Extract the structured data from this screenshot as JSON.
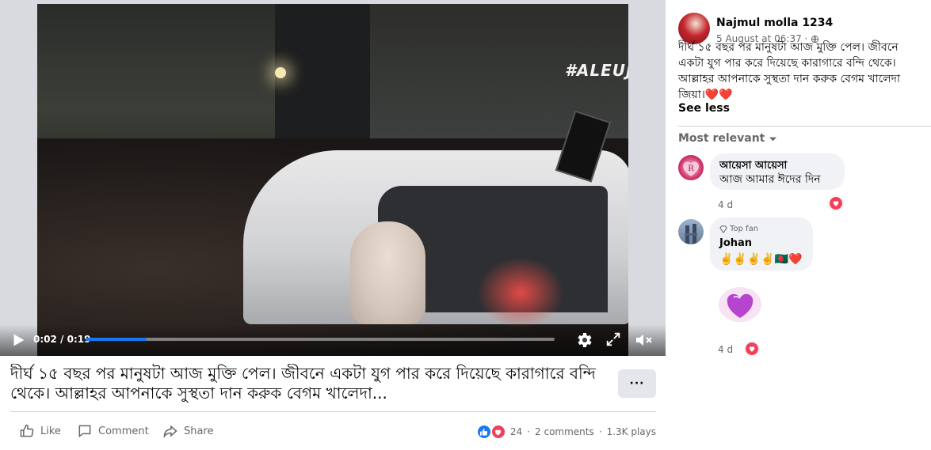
{
  "video": {
    "watermark": "#ALEUJAR",
    "time_current": "0:02",
    "time_separator": " / ",
    "time_total": "0:19",
    "progress": 0.13
  },
  "post": {
    "caption": "দীর্ঘ ১৫ বছর পর মানুষটা আজ মুক্তি পেল। জীবনে একটা যুগ পার করে দিয়েছে কারাগারে বন্দি থেকে। আল্লাহর আপনাকে সুস্থতা দান করুক বেগম খালেদা...",
    "more_label": "···",
    "actions": {
      "like": "Like",
      "comment": "Comment",
      "share": "Share"
    },
    "stats": {
      "reactions": "24",
      "comments": "2 comments",
      "separator": "·",
      "plays": "1.3K plays"
    }
  },
  "panel": {
    "author": "Najmul molla 1234",
    "timestamp": "5 August at 06:37 ·",
    "text": "দীর্ঘ ১৫ বছর পর মানুষটা আজ মুক্তি পেল। জীবনে একটা যুগ পার করে দিয়েছে কারাগারে বন্দি থেকে। আল্লাহর আপনাকে সুস্থতা দান করুক বেগম খালেদা জিয়া।❤️❤️",
    "see_less": "See less",
    "sort_label": "Most relevant",
    "comments": [
      {
        "name": "আয়েসা আয়েসা",
        "text": "আজ আমার ঈদের দিন",
        "time": "4 d",
        "avatar_letter": "R"
      },
      {
        "badge": "Top fan",
        "name": "Johan",
        "text": "✌️✌️✌️✌️🇧🇩❤️",
        "time": "4 d"
      }
    ]
  },
  "colors": {
    "accent": "#1877f2",
    "love": "#f33e58",
    "muted": "#65676b"
  }
}
